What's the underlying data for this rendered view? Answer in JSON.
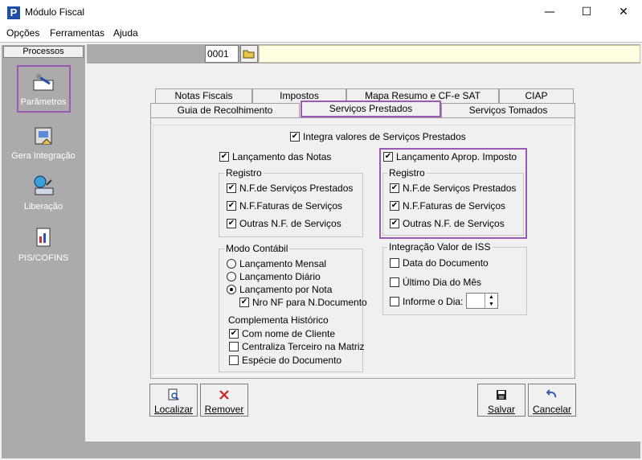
{
  "window": {
    "title": "Módulo Fiscal",
    "minimize": "—",
    "maximize": "☐",
    "close": "✕"
  },
  "menu": [
    "Opções",
    "Ferramentas",
    "Ajuda"
  ],
  "toolbar": {
    "code_value": "0001"
  },
  "sidebar": {
    "header": "Processos",
    "items": [
      {
        "label": "Parâmetros",
        "icon": "parameters-icon"
      },
      {
        "label": "Gera Integração",
        "icon": "integration-icon"
      },
      {
        "label": "Liberação",
        "icon": "release-icon"
      },
      {
        "label": "PIS/COFINS",
        "icon": "pis-cofins-icon"
      }
    ]
  },
  "tabs": {
    "row1": [
      "Notas Fiscais",
      "Impostos",
      "Mapa Resumo e CF-e SAT",
      "CIAP"
    ],
    "row2": [
      "Guia de Recolhimento",
      "Serviços Prestados",
      "Serviços Tomados"
    ],
    "active": "Serviços Prestados"
  },
  "content": {
    "integra": {
      "label": "Integra valores de Serviços Prestados",
      "checked": true
    },
    "lanc_notas": {
      "label": "Lançamento das Notas",
      "checked": true
    },
    "registro_left": {
      "title": "Registro",
      "items": [
        "N.F.de Serviços Prestados",
        "N.F.Faturas de Serviços",
        "Outras N.F. de Serviços"
      ]
    },
    "modo": {
      "title": "Modo Contábil",
      "options": [
        "Lançamento Mensal",
        "Lançamento Diário",
        "Lançamento por Nota"
      ],
      "selected": "Lançamento por Nota",
      "nro_nf": "Nro NF para N.Documento"
    },
    "complementa": {
      "title": "Complementa Histórico",
      "items": [
        "Com nome de Cliente",
        "Centraliza Terceiro na Matriz",
        "Espécie do Documento"
      ]
    },
    "lanc_aprop": {
      "label": "Lançamento Aprop. Imposto",
      "checked": true
    },
    "registro_right": {
      "title": "Registro",
      "items": [
        "N.F.de Serviços Prestados",
        "N.F.Faturas de Serviços",
        "Outras N.F. de Serviços"
      ]
    },
    "iss": {
      "title": "Integração Valor de ISS",
      "items": [
        "Data do Documento",
        "Último Dia do Mês",
        "Informe o Dia:"
      ]
    }
  },
  "buttons": {
    "localizar": "Localizar",
    "remover": "Remover",
    "salvar": "Salvar",
    "cancelar": "Cancelar"
  },
  "check_mark": "✔",
  "accent": "#9b59b6"
}
